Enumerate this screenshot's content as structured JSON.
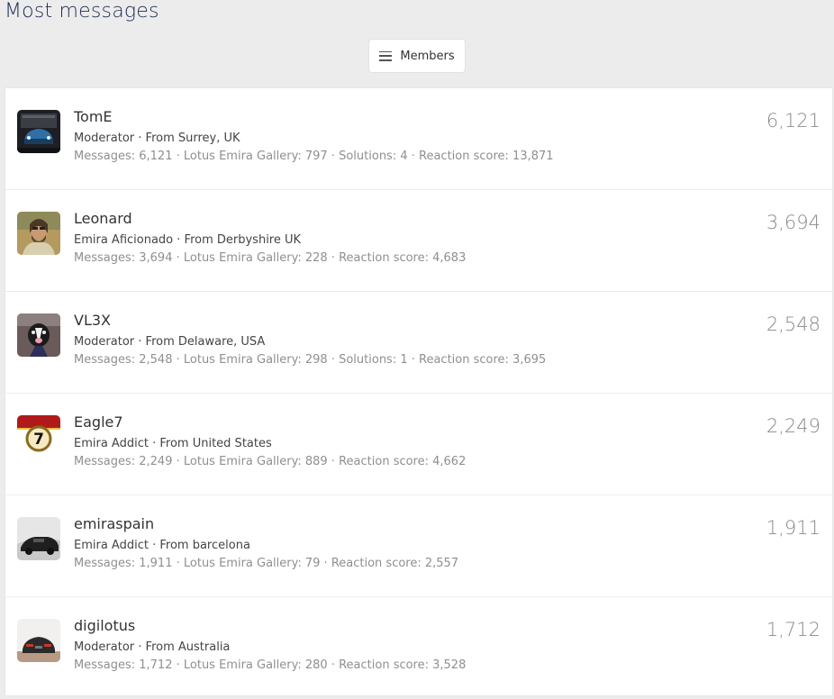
{
  "page": {
    "title": "Most messages"
  },
  "members_button": {
    "label": "Members",
    "icon": "hamburger-menu-icon"
  },
  "members": [
    {
      "name": "TomE",
      "title": "Moderator",
      "location": "From Surrey, UK",
      "stats": "Messages: 6,121 · Lotus Emira Gallery: 797 · Solutions: 4 · Reaction score: 13,871",
      "count": "6,121",
      "avatar": "car-garage-photo"
    },
    {
      "name": "Leonard",
      "title": "Emira Aficionado",
      "location": "From Derbyshire UK",
      "stats": "Messages: 3,694 · Lotus Emira Gallery: 228 · Reaction score: 4,683",
      "count": "3,694",
      "avatar": "bearded-man-photo"
    },
    {
      "name": "VL3X",
      "title": "Moderator",
      "location": "From Delaware, USA",
      "stats": "Messages: 2,548 · Lotus Emira Gallery: 298 · Solutions: 1 · Reaction score: 3,695",
      "count": "2,548",
      "avatar": "dog-photo"
    },
    {
      "name": "Eagle7",
      "title": "Emira Addict",
      "location": "From United States",
      "stats": "Messages: 2,249 · Lotus Emira Gallery: 889 · Reaction score: 4,662",
      "count": "2,249",
      "avatar": "number-7-roundel",
      "avatar_text": "7"
    },
    {
      "name": "emiraspain",
      "title": "Emira Addict",
      "location": "From barcelona",
      "stats": "Messages: 1,911 · Lotus Emira Gallery: 79 · Reaction score: 2,557",
      "count": "1,911",
      "avatar": "black-car-snow-photo"
    },
    {
      "name": "digilotus",
      "title": "Moderator",
      "location": "From Australia",
      "stats": "Messages: 1,712 · Lotus Emira Gallery: 280 · Reaction score: 3,528",
      "count": "1,712",
      "avatar": "car-rear-photo"
    }
  ]
}
